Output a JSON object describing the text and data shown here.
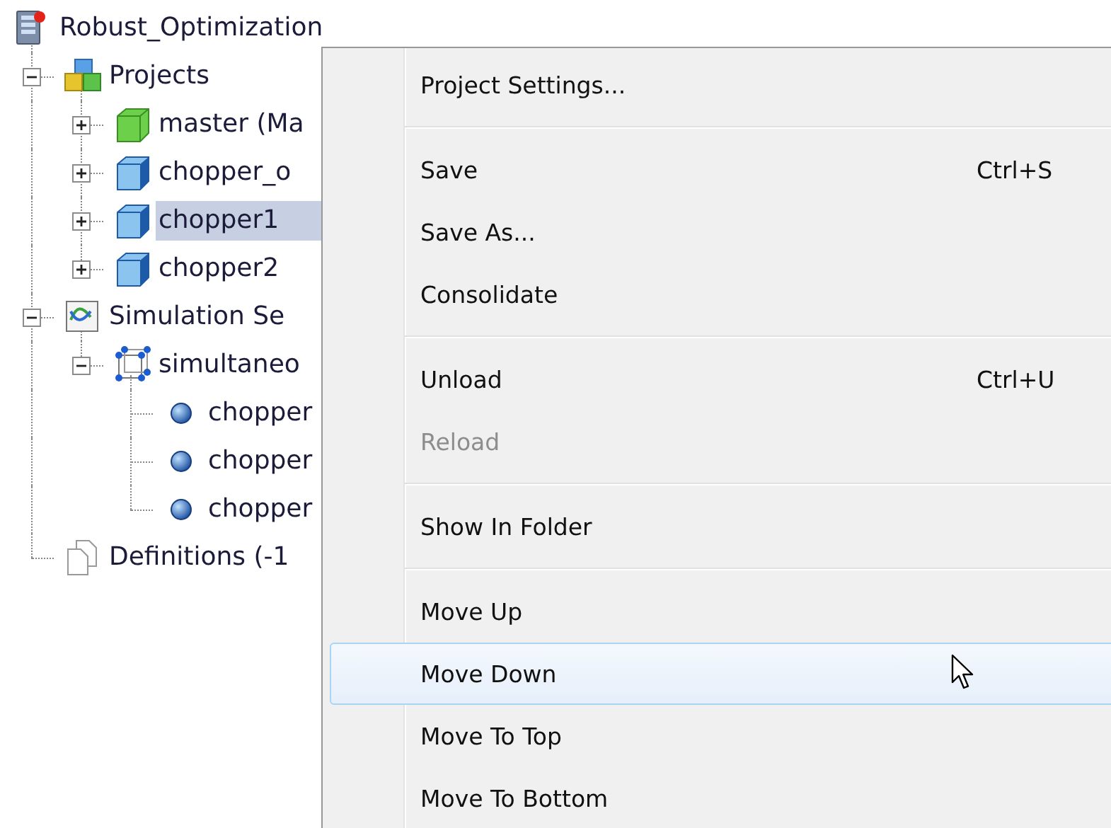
{
  "tree": {
    "label": "Robust_Optimization",
    "kind": "root",
    "selected": false,
    "children": [
      {
        "label": "Projects",
        "kind": "projects",
        "selected": false,
        "expanded": true,
        "children": [
          {
            "label": "master (Ma",
            "kind": "project-green",
            "selected": false,
            "expanded": false
          },
          {
            "label": "chopper_o",
            "kind": "project-blue",
            "selected": false,
            "expanded": false
          },
          {
            "label": "chopper1",
            "kind": "project-blue",
            "selected": true,
            "expanded": false
          },
          {
            "label": "chopper2",
            "kind": "project-blue",
            "selected": false,
            "expanded": false
          }
        ]
      },
      {
        "label": "Simulation Se",
        "kind": "simulation",
        "selected": false,
        "expanded": true,
        "children": [
          {
            "label": "simultaneo",
            "kind": "simultaneous",
            "selected": false,
            "expanded": true,
            "children": [
              {
                "label": "chopper",
                "kind": "sphere",
                "selected": false
              },
              {
                "label": "chopper",
                "kind": "sphere",
                "selected": false
              },
              {
                "label": "chopper",
                "kind": "sphere",
                "selected": false
              }
            ]
          }
        ]
      },
      {
        "label": "Definitions (-1",
        "kind": "definitions",
        "selected": false
      }
    ]
  },
  "context_menu": {
    "items": [
      {
        "kind": "item",
        "label": "Project Settings...",
        "disabled": false,
        "selected": false
      },
      {
        "kind": "separator"
      },
      {
        "kind": "item",
        "label": "Save",
        "shortcut": "Ctrl+S",
        "disabled": false,
        "selected": false
      },
      {
        "kind": "item",
        "label": "Save As...",
        "disabled": false,
        "selected": false
      },
      {
        "kind": "item",
        "label": "Consolidate",
        "disabled": false,
        "selected": false
      },
      {
        "kind": "separator"
      },
      {
        "kind": "item",
        "label": "Unload",
        "shortcut": "Ctrl+U",
        "disabled": false,
        "selected": false
      },
      {
        "kind": "item",
        "label": "Reload",
        "disabled": true,
        "selected": false
      },
      {
        "kind": "separator"
      },
      {
        "kind": "item",
        "label": "Show In Folder",
        "disabled": false,
        "selected": false
      },
      {
        "kind": "separator"
      },
      {
        "kind": "item",
        "label": "Move Up",
        "disabled": false,
        "selected": false
      },
      {
        "kind": "item",
        "label": "Move Down",
        "disabled": false,
        "selected": true
      },
      {
        "kind": "item",
        "label": "Move To Top",
        "disabled": false,
        "selected": false
      },
      {
        "kind": "item",
        "label": "Move To Bottom",
        "disabled": false,
        "selected": false
      }
    ]
  }
}
